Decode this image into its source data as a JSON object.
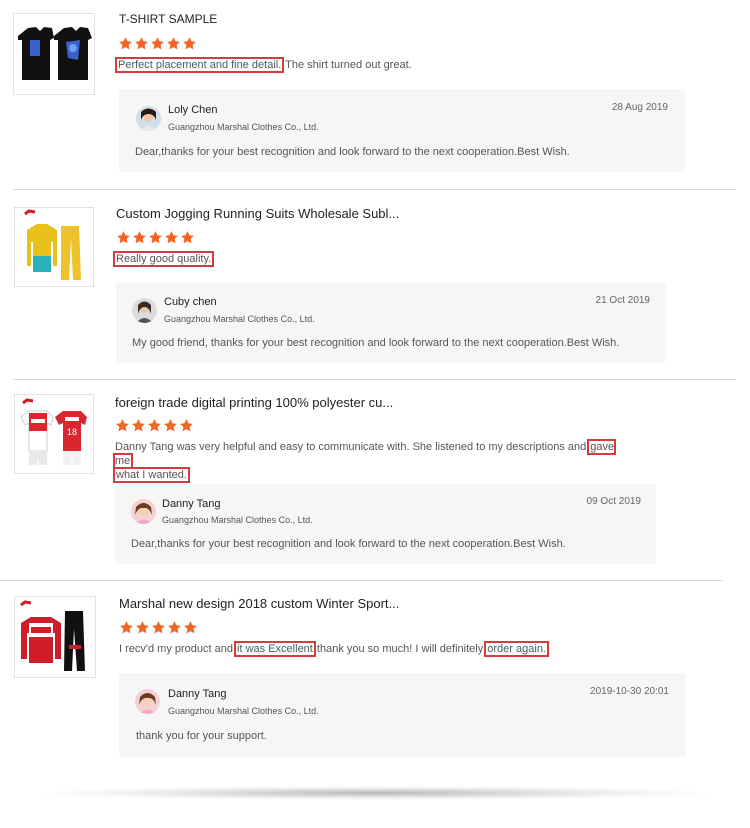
{
  "colors": {
    "star": "#f26522",
    "highlight": "#d63b3b",
    "reply_bg": "#f6f6f6"
  },
  "reviews": [
    {
      "product_title": "T-SHIRT SAMPLE",
      "rating": 5,
      "comment_parts": [
        "Perfect placement and fine detail.",
        " The shirt turned out great."
      ],
      "reply": {
        "name": "Loly Chen",
        "company": "Guangzhou Marshal Clothes Co., Ltd.",
        "date": "28 Aug 2019",
        "text": "Dear,thanks for your best recognition and look forward to the next cooperation.Best Wish."
      }
    },
    {
      "product_title": "Custom Jogging Running Suits Wholesale Subl...",
      "rating": 5,
      "comment_parts": [
        "Really good quality."
      ],
      "reply": {
        "name": "Cuby chen",
        "company": "Guangzhou Marshal Clothes Co., Ltd.",
        "date": "21 Oct 2019",
        "text": "My good friend, thanks for your best recognition and look forward to the next cooperation.Best Wish."
      }
    },
    {
      "product_title": "foreign trade digital printing 100% polyester cu...",
      "rating": 5,
      "comment_parts": [
        "Danny Tang was very helpful and easy to communicate with. She listened to my descriptions and ",
        "gave me",
        "what I wanted."
      ],
      "reply": {
        "name": "Danny Tang",
        "company": "Guangzhou Marshal Clothes Co., Ltd.",
        "date": "09 Oct 2019",
        "text": "Dear,thanks for your best recognition and look forward to the next cooperation.Best Wish."
      }
    },
    {
      "product_title": "Marshal new design 2018 custom Winter Sport...",
      "rating": 5,
      "comment_parts": [
        "I recv'd my product and ",
        "it was Excellent",
        " thank you so much! I will definitely ",
        "order again."
      ],
      "reply": {
        "name": "Danny Tang",
        "company": "Guangzhou Marshal Clothes Co., Ltd.",
        "date": "2019-10-30 20:01",
        "text": "thank you for your support."
      }
    }
  ]
}
